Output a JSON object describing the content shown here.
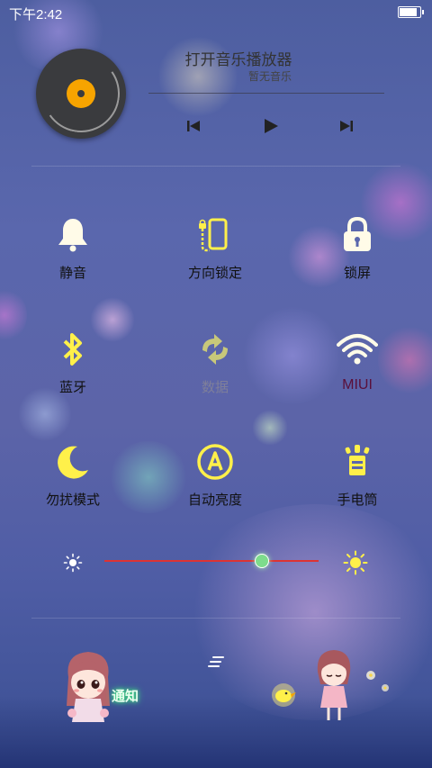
{
  "status_bar": {
    "time": "下午2:42",
    "battery_percent": 85
  },
  "music": {
    "title": "打开音乐播放器",
    "subtitle": "暂无音乐",
    "controls": [
      "previous-icon",
      "play-icon",
      "next-icon"
    ]
  },
  "toggles": [
    {
      "label": "静音",
      "icon": "bell-icon"
    },
    {
      "label": "方向锁定",
      "icon": "rotation-lock-icon"
    },
    {
      "label": "锁屏",
      "icon": "lock-icon"
    },
    {
      "label": "蓝牙",
      "icon": "bluetooth-icon"
    },
    {
      "label": "数据",
      "icon": "data-sync-icon",
      "state": "off"
    },
    {
      "label": "MIUI",
      "icon": "wifi-icon"
    },
    {
      "label": "勿扰模式",
      "icon": "moon-icon"
    },
    {
      "label": "自动亮度",
      "icon": "auto-brightness-icon"
    },
    {
      "label": "手电筒",
      "icon": "flashlight-icon"
    }
  ],
  "brightness": {
    "level": 0.73
  },
  "bottom": {
    "notification_label": "通知"
  },
  "colors": {
    "accent_yellow": "#fff04a",
    "slider_red": "#d33333",
    "disc_orange": "#f7a400"
  }
}
